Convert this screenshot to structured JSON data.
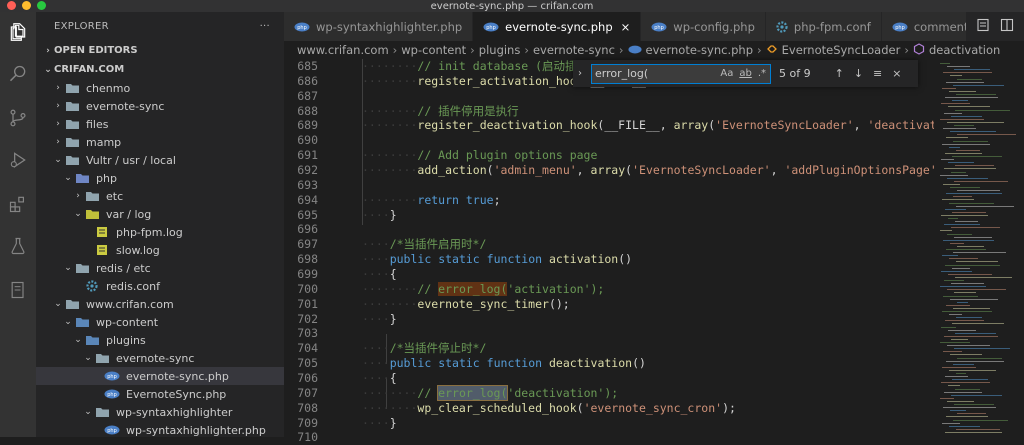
{
  "window": {
    "title": "evernote-sync.php — crifan.com",
    "traffic_colors": [
      "#ff5f57",
      "#febc2e",
      "#28c840"
    ]
  },
  "activity_bar": {
    "icons": [
      "files-icon",
      "search-icon",
      "source-control-icon",
      "run-debug-icon",
      "extensions-icon",
      "flask-icon",
      "notebook-icon"
    ]
  },
  "sidebar": {
    "title": "EXPLORER",
    "more": "···",
    "open_editors": "OPEN EDITORS",
    "workspace": "CRIFAN.COM",
    "tree": [
      {
        "label": "chenmo",
        "depth": 1,
        "type": "folder",
        "open": false
      },
      {
        "label": "evernote-sync",
        "depth": 1,
        "type": "folder",
        "open": false
      },
      {
        "label": "files",
        "depth": 1,
        "type": "folder",
        "open": false
      },
      {
        "label": "mamp",
        "depth": 1,
        "type": "folder",
        "open": false
      },
      {
        "label": "Vultr / usr / local",
        "depth": 1,
        "type": "folder",
        "open": true
      },
      {
        "label": "php",
        "depth": 2,
        "type": "folder-php",
        "open": true
      },
      {
        "label": "etc",
        "depth": 3,
        "type": "folder",
        "open": false
      },
      {
        "label": "var / log",
        "depth": 3,
        "type": "folder-log",
        "open": true
      },
      {
        "label": "php-fpm.log",
        "depth": 4,
        "type": "file-log"
      },
      {
        "label": "slow.log",
        "depth": 4,
        "type": "file-log"
      },
      {
        "label": "redis / etc",
        "depth": 2,
        "type": "folder",
        "open": true
      },
      {
        "label": "redis.conf",
        "depth": 3,
        "type": "file-conf"
      },
      {
        "label": "www.crifan.com",
        "depth": 1,
        "type": "folder",
        "open": true
      },
      {
        "label": "wp-content",
        "depth": 2,
        "type": "folder-wp",
        "open": true
      },
      {
        "label": "plugins",
        "depth": 3,
        "type": "folder-plugins",
        "open": true
      },
      {
        "label": "evernote-sync",
        "depth": 4,
        "type": "folder",
        "open": true
      },
      {
        "label": "evernote-sync.php",
        "depth": 5,
        "type": "file-php",
        "selected": true
      },
      {
        "label": "EvernoteSync.php",
        "depth": 5,
        "type": "file-php"
      },
      {
        "label": "wp-syntaxhighlighter",
        "depth": 4,
        "type": "folder",
        "open": true
      },
      {
        "label": "wp-syntaxhighlighter.php",
        "depth": 5,
        "type": "file-php"
      }
    ]
  },
  "tabs": [
    {
      "label": "wp-syntaxhighlighter.php",
      "icon": "php-file-icon",
      "active": false
    },
    {
      "label": "evernote-sync.php",
      "icon": "php-file-icon",
      "active": true,
      "close": "×"
    },
    {
      "label": "wp-config.php",
      "icon": "php-file-icon",
      "active": false
    },
    {
      "label": "php-fpm.conf",
      "icon": "gear-file-icon",
      "active": false
    },
    {
      "label": "comments.pl",
      "icon": "php-file-icon",
      "active": false
    }
  ],
  "breadcrumb": [
    "www.crifan.com",
    "wp-content",
    "plugins",
    "evernote-sync",
    "evernote-sync.php",
    "EvernoteSyncLoader",
    "deactivation"
  ],
  "find": {
    "query": "error_log(",
    "opt_case": "Aa",
    "opt_word": "ab",
    "opt_regex": ".*",
    "result": "5 of 9"
  },
  "code": {
    "lines": [
      {
        "n": "685",
        "indent": 2,
        "parts": [
          {
            "t": "// init database (启动插件是执行)",
            "c": "c-com"
          }
        ]
      },
      {
        "n": "686",
        "indent": 2,
        "parts": [
          {
            "t": "register_activation_hook",
            "c": "c-fn"
          },
          {
            "t": "(__FILE__, ",
            "c": "c-txt"
          }
        ]
      },
      {
        "n": "687",
        "indent": 0,
        "parts": []
      },
      {
        "n": "688",
        "indent": 2,
        "parts": [
          {
            "t": "// 插件停用是执行",
            "c": "c-com"
          }
        ]
      },
      {
        "n": "689",
        "indent": 2,
        "parts": [
          {
            "t": "register_deactivation_hook",
            "c": "c-fn"
          },
          {
            "t": "(__FILE__, ",
            "c": "c-txt"
          },
          {
            "t": "array",
            "c": "c-fn"
          },
          {
            "t": "(",
            "c": "c-txt"
          },
          {
            "t": "'EvernoteSyncLoader'",
            "c": "c-str"
          },
          {
            "t": ", ",
            "c": "c-txt"
          },
          {
            "t": "'deactivation'",
            "c": "c-str"
          },
          {
            "t": "));",
            "c": "c-txt"
          }
        ]
      },
      {
        "n": "690",
        "indent": 0,
        "parts": []
      },
      {
        "n": "691",
        "indent": 2,
        "parts": [
          {
            "t": "// Add plugin options page",
            "c": "c-com"
          }
        ]
      },
      {
        "n": "692",
        "indent": 2,
        "parts": [
          {
            "t": "add_action",
            "c": "c-fn"
          },
          {
            "t": "(",
            "c": "c-txt"
          },
          {
            "t": "'admin_menu'",
            "c": "c-str"
          },
          {
            "t": ", ",
            "c": "c-txt"
          },
          {
            "t": "array",
            "c": "c-fn"
          },
          {
            "t": "(",
            "c": "c-txt"
          },
          {
            "t": "'EvernoteSyncLoader'",
            "c": "c-str"
          },
          {
            "t": ", ",
            "c": "c-txt"
          },
          {
            "t": "'addPluginOptionsPage'",
            "c": "c-str"
          },
          {
            "t": "));",
            "c": "c-txt"
          }
        ]
      },
      {
        "n": "693",
        "indent": 0,
        "parts": []
      },
      {
        "n": "694",
        "indent": 2,
        "parts": [
          {
            "t": "return",
            "c": "c-kw"
          },
          {
            "t": " ",
            "c": "c-txt"
          },
          {
            "t": "true",
            "c": "c-kw"
          },
          {
            "t": ";",
            "c": "c-txt"
          }
        ]
      },
      {
        "n": "695",
        "indent": 1,
        "parts": [
          {
            "t": "}",
            "c": "c-txt"
          }
        ]
      },
      {
        "n": "696",
        "indent": 0,
        "parts": []
      },
      {
        "n": "697",
        "indent": 1,
        "parts": [
          {
            "t": "/*当插件启用时*/",
            "c": "c-com"
          }
        ]
      },
      {
        "n": "698",
        "indent": 1,
        "parts": [
          {
            "t": "public",
            "c": "c-kw"
          },
          {
            "t": " ",
            "c": "c-txt"
          },
          {
            "t": "static",
            "c": "c-kw"
          },
          {
            "t": " ",
            "c": "c-txt"
          },
          {
            "t": "function",
            "c": "c-kw"
          },
          {
            "t": " ",
            "c": "c-txt"
          },
          {
            "t": "activation",
            "c": "c-fn"
          },
          {
            "t": "()",
            "c": "c-txt"
          }
        ]
      },
      {
        "n": "699",
        "indent": 1,
        "parts": [
          {
            "t": "{",
            "c": "c-txt"
          }
        ]
      },
      {
        "n": "700",
        "indent": 2,
        "parts": [
          {
            "t": "// ",
            "c": "c-com"
          },
          {
            "t": "error_log(",
            "c": "c-com hl"
          },
          {
            "t": "'activation');",
            "c": "c-com"
          }
        ]
      },
      {
        "n": "701",
        "indent": 2,
        "parts": [
          {
            "t": "evernote_sync_timer",
            "c": "c-fn"
          },
          {
            "t": "();",
            "c": "c-txt"
          }
        ]
      },
      {
        "n": "702",
        "indent": 1,
        "parts": [
          {
            "t": "}",
            "c": "c-txt"
          }
        ]
      },
      {
        "n": "703",
        "indent": 0,
        "parts": []
      },
      {
        "n": "704",
        "indent": 1,
        "parts": [
          {
            "t": "/*当插件停止时*/",
            "c": "c-com"
          }
        ]
      },
      {
        "n": "705",
        "indent": 1,
        "parts": [
          {
            "t": "public",
            "c": "c-kw"
          },
          {
            "t": " ",
            "c": "c-txt"
          },
          {
            "t": "static",
            "c": "c-kw"
          },
          {
            "t": " ",
            "c": "c-txt"
          },
          {
            "t": "function",
            "c": "c-kw"
          },
          {
            "t": " ",
            "c": "c-txt"
          },
          {
            "t": "deactivation",
            "c": "c-fn"
          },
          {
            "t": "()",
            "c": "c-txt"
          }
        ]
      },
      {
        "n": "706",
        "indent": 1,
        "parts": [
          {
            "t": "{",
            "c": "c-txt"
          }
        ]
      },
      {
        "n": "707",
        "indent": 2,
        "parts": [
          {
            "t": "// ",
            "c": "c-com"
          },
          {
            "t": "error_log(",
            "c": "c-com hl-cur"
          },
          {
            "t": "'deactivation');",
            "c": "c-com"
          }
        ]
      },
      {
        "n": "708",
        "indent": 2,
        "parts": [
          {
            "t": "wp_clear_scheduled_hook",
            "c": "c-fn"
          },
          {
            "t": "(",
            "c": "c-txt"
          },
          {
            "t": "'evernote_sync_cron'",
            "c": "c-str"
          },
          {
            "t": ");",
            "c": "c-txt"
          }
        ]
      },
      {
        "n": "709",
        "indent": 1,
        "parts": [
          {
            "t": "}",
            "c": "c-txt"
          }
        ]
      },
      {
        "n": "710",
        "indent": 0,
        "parts": []
      }
    ]
  }
}
